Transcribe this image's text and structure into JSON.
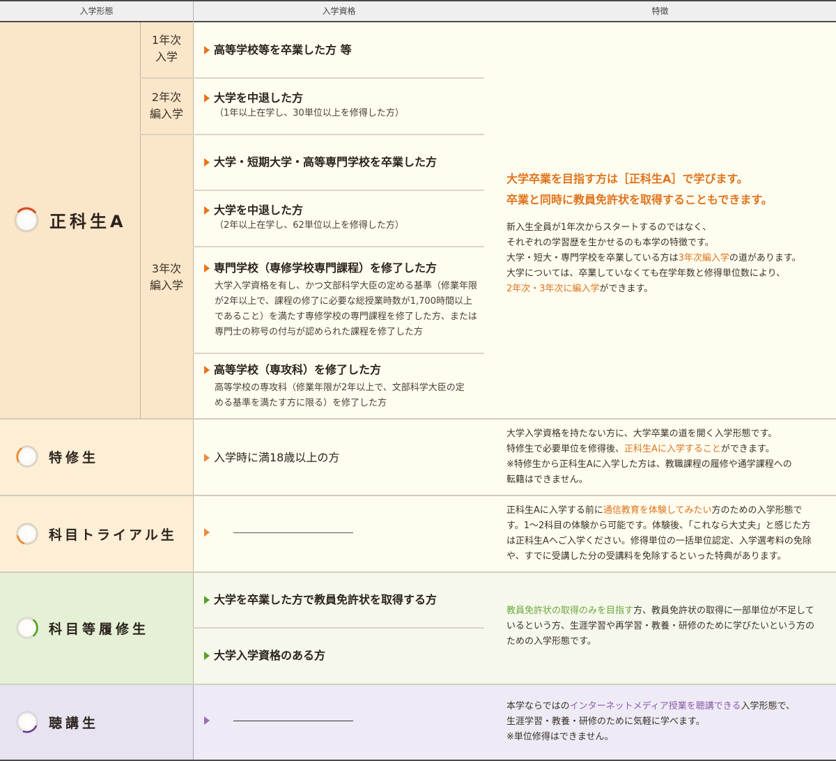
{
  "header": {
    "col_type": "入学形態",
    "col_qualification": "入学資格",
    "col_features": "特徴"
  },
  "colors": {
    "orange_accent": "#e0731b",
    "green_accent": "#6aa93a",
    "purple_accent": "#8d5aa8",
    "seika_bg": "#fbe6c9",
    "tokushu_bg": "#fdeed6",
    "rishu_bg": "#e5f0d6",
    "choko_bg": "#e7e3f1"
  },
  "seika_a": {
    "name": "正科生A",
    "icon": "ring-icon",
    "years": [
      {
        "label_1": "1年次",
        "label_2": "入学"
      },
      {
        "label_1": "2年次",
        "label_2": "編入学"
      },
      {
        "label_1": "3年次",
        "label_2": "編入学"
      }
    ],
    "qualifications": [
      {
        "title": "高等学校等を卒業した方 等",
        "note": ""
      },
      {
        "title": "大学を中退した方",
        "note": "（1年以上在学し、30単位以上を修得した方）"
      },
      {
        "title": "大学・短期大学・高等専門学校を卒業した方",
        "note": ""
      },
      {
        "title": "大学を中退した方",
        "note": "（2年以上在学し、62単位以上を修得した方）"
      },
      {
        "title": "専門学校（専修学校専門課程）を修了した方",
        "note": "大学入学資格を有し、かつ文部科学大臣の定める基準（修業年限が2年以上で、課程の修了に必要な総授業時数が1,700時間以上であること）を満たす専修学校の専門課程を修了した方、または専門士の称号の付与が認められた課程を修了した方"
      },
      {
        "title": "高等学校（専攻科）を修了した方",
        "note": "高等学校の専攻科（修業年限が2年以上で、文部科学大臣の定める基準を満たす方に限る）を修了した方"
      }
    ],
    "features": {
      "lead_1": "大学卒業を目指す方は［正科生A］で学びます。",
      "lead_2": "卒業と同時に教員免許状を取得することもできます。",
      "line_1": "新入生全員が1年次からスタートするのではなく、",
      "line_2": "それぞれの学習歴を生かせるのも本学の特徴です。",
      "line_3_a": "大学・短大・専門学校を卒業している方は",
      "line_3_hl": "3年次編入学",
      "line_3_b": "の道があります。",
      "line_4": "大学については、卒業していなくても在学年数と修得単位数により、",
      "line_5_hl": "2年次・3年次に編入学",
      "line_5_b": "ができます。"
    }
  },
  "tokushu": {
    "name": "特修生",
    "qualification": "入学時に満18歳以上の方",
    "features": {
      "line_1": "大学入学資格を持たない方に、大学卒業の道を開く入学形態です。",
      "line_2_a": "特修生で必要単位を修得後、",
      "line_2_hl": "正科生Aに入学すること",
      "line_2_b": "ができます。",
      "line_3": "※特修生から正科生Aに入学した方は、教職課程の履修や通学課程への",
      "line_4": "転籍はできません。"
    }
  },
  "trial": {
    "name": "科目トライアル生",
    "qualification": "―",
    "features": {
      "a": "正科生Aに入学する前に",
      "hl": "通信教育を体験してみたい",
      "b": "方のための入学形態です。1～2科目の体験から可能です。体験後、「これなら大丈夫」と感じた方は正科生Aへご入学ください。修得単位の一括単位認定、入学選考料の免除や、すでに受講した分の受講料を免除するといった特典があります。"
    }
  },
  "rishu": {
    "name": "科目等履修生",
    "qualifications": [
      "大学を卒業した方で教員免許状を取得する方",
      "大学入学資格のある方"
    ],
    "features": {
      "hl": "教員免許状の取得のみを目指す",
      "b": "方、教員免許状の取得に一部単位が不足しているという方、生涯学習や再学習・教養・研修のために学びたいという方のための入学形態です。"
    }
  },
  "choko": {
    "name": "聴講生",
    "qualification": "―",
    "features": {
      "line_1_a": "本学ならではの",
      "line_1_hl": "インターネットメディア授業を聴講できる",
      "line_1_b": "入学形態で、",
      "line_2": "生涯学習・教養・研修のために気軽に学べます。",
      "line_3": "※単位修得はできません。"
    }
  }
}
